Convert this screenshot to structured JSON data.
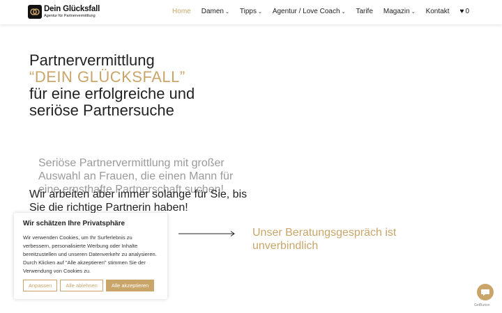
{
  "brand": {
    "name": "Dein Glücksfall",
    "tagline": "Agentur für Partnervermittlung"
  },
  "nav": {
    "items": [
      {
        "label": "Home",
        "active": true,
        "dropdown": false
      },
      {
        "label": "Damen",
        "active": false,
        "dropdown": true
      },
      {
        "label": "Tipps",
        "active": false,
        "dropdown": true
      },
      {
        "label": "Agentur / Love Coach",
        "active": false,
        "dropdown": true
      },
      {
        "label": "Tarife",
        "active": false,
        "dropdown": false
      },
      {
        "label": "Magazin",
        "active": false,
        "dropdown": true
      },
      {
        "label": "Kontakt",
        "active": false,
        "dropdown": false
      }
    ],
    "wishlist_count": "0",
    "wishlist_icon": "heart-icon"
  },
  "hero": {
    "line1": "Partnervermittlung",
    "accent": "“DEIN GLÜCKSFALL”",
    "line3": "für eine erfolgreiche und",
    "line4": "seriöse Partnersuche"
  },
  "content": {
    "faded_text": "Seriöse Partnervermittlung mit großer Auswahl an Frauen, die einen Mann für eine ernsthafte Partnerschaft suchen!",
    "main_text": "Wir arbeiten aber immer solange für Sie, bis Sie die richtige Partnerin haben!",
    "consult_text": "Unser Beratungsgespräch ist unverbindlich"
  },
  "cookie": {
    "title": "Wir schätzen Ihre Privatsphäre",
    "text": "Wir verwenden Cookies, um Ihr Surferlebnis zu verbessern, personalisierte Werbung oder Inhalte bereitzustellen und unseren Datenverkehr zu analysieren. Durch Klicken auf \"Alle akzeptieren\" stimmen Sie der Verwendung von Cookies zu.",
    "customize_label": "Anpassen",
    "reject_label": "Alle ablehnen",
    "accept_label": "Alle akzeptieren"
  },
  "widgets": {
    "chat_icon": "chat-bubble-icon",
    "getbutton_label": "GetButton"
  },
  "colors": {
    "accent": "#c9a56a",
    "text": "#222222",
    "faded": "#9a9a9a"
  }
}
